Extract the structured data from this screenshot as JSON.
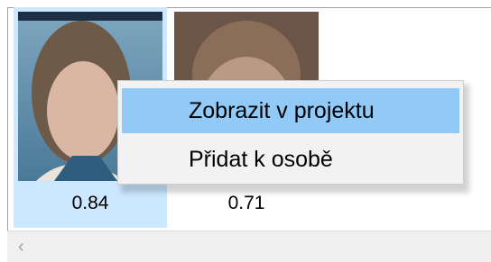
{
  "thumbnails": [
    {
      "score": "0.84",
      "selected": true
    },
    {
      "score": "0.71",
      "selected": false
    }
  ],
  "context_menu": {
    "items": [
      {
        "label": "Zobrazit v projektu",
        "highlighted": true
      },
      {
        "label": "Přidat k osobě",
        "highlighted": false
      }
    ]
  },
  "scrollbar": {
    "left_arrow_icon": "chevron-left-icon"
  },
  "colors": {
    "selection": "#cce8ff",
    "menu_highlight": "#91c9f7",
    "menu_background": "#f2f2f2"
  }
}
